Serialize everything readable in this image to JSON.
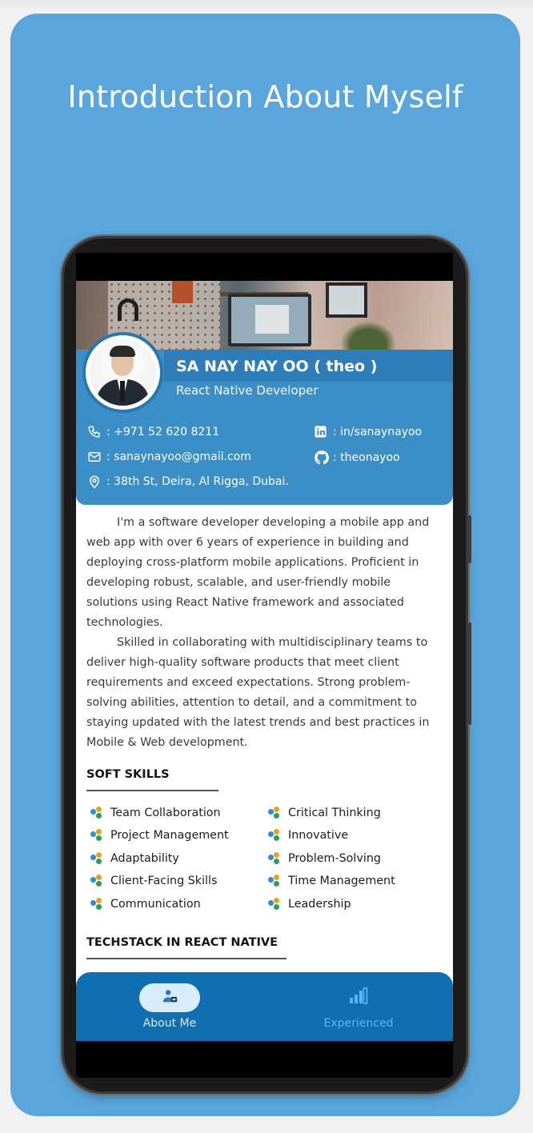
{
  "promo": {
    "title": "Introduction About Myself"
  },
  "profile": {
    "name": "SA NAY NAY OO ( theo )",
    "role": "React Native Developer"
  },
  "contacts": {
    "phone": ": +971 52 620 8211",
    "email": ": sanaynayoo@gmail.com",
    "address": ": 38th St, Deira, Al Rigga, Dubai.",
    "linkedin": ": in/sanaynayoo",
    "github": ": theonayoo"
  },
  "bio": {
    "p1": "I'm a software developer developing a mobile app and web app with over 6 years of experience in building and deploying cross-platform mobile applications. Proficient in developing robust, scalable, and user-friendly mobile solutions using React Native framework and associated technologies.",
    "p2": "Skilled in collaborating with multidisciplinary teams to deliver high-quality software products that meet client requirements and exceed expectations. Strong problem-solving abilities, attention to detail, and a commitment to staying updated with the latest trends and best practices in Mobile & Web development."
  },
  "sections": {
    "soft_skills": "SOFT SKILLS",
    "techstack": "TECHSTACK IN REACT NATIVE"
  },
  "skills": [
    "Team Collaboration",
    "Critical Thinking",
    "Project Management",
    "Innovative",
    "Adaptability",
    "Problem-Solving",
    "Client-Facing Skills",
    "Time Management",
    "Communication",
    "Leadership"
  ],
  "nav": {
    "about": "About Me",
    "experienced": "Experienced"
  },
  "colors": {
    "card_bg": "#5aa6dc",
    "header_bg": "#3b8ec6",
    "nav_bg": "#0f6fb0",
    "nav_active_pill": "#d9ecfa",
    "nav_inactive_text": "#5ab6f0"
  },
  "icons": [
    "phone-icon",
    "mail-icon",
    "location-icon",
    "linkedin-icon",
    "github-icon",
    "skill-dots-icon",
    "person-badge-icon",
    "bar-chart-icon"
  ]
}
